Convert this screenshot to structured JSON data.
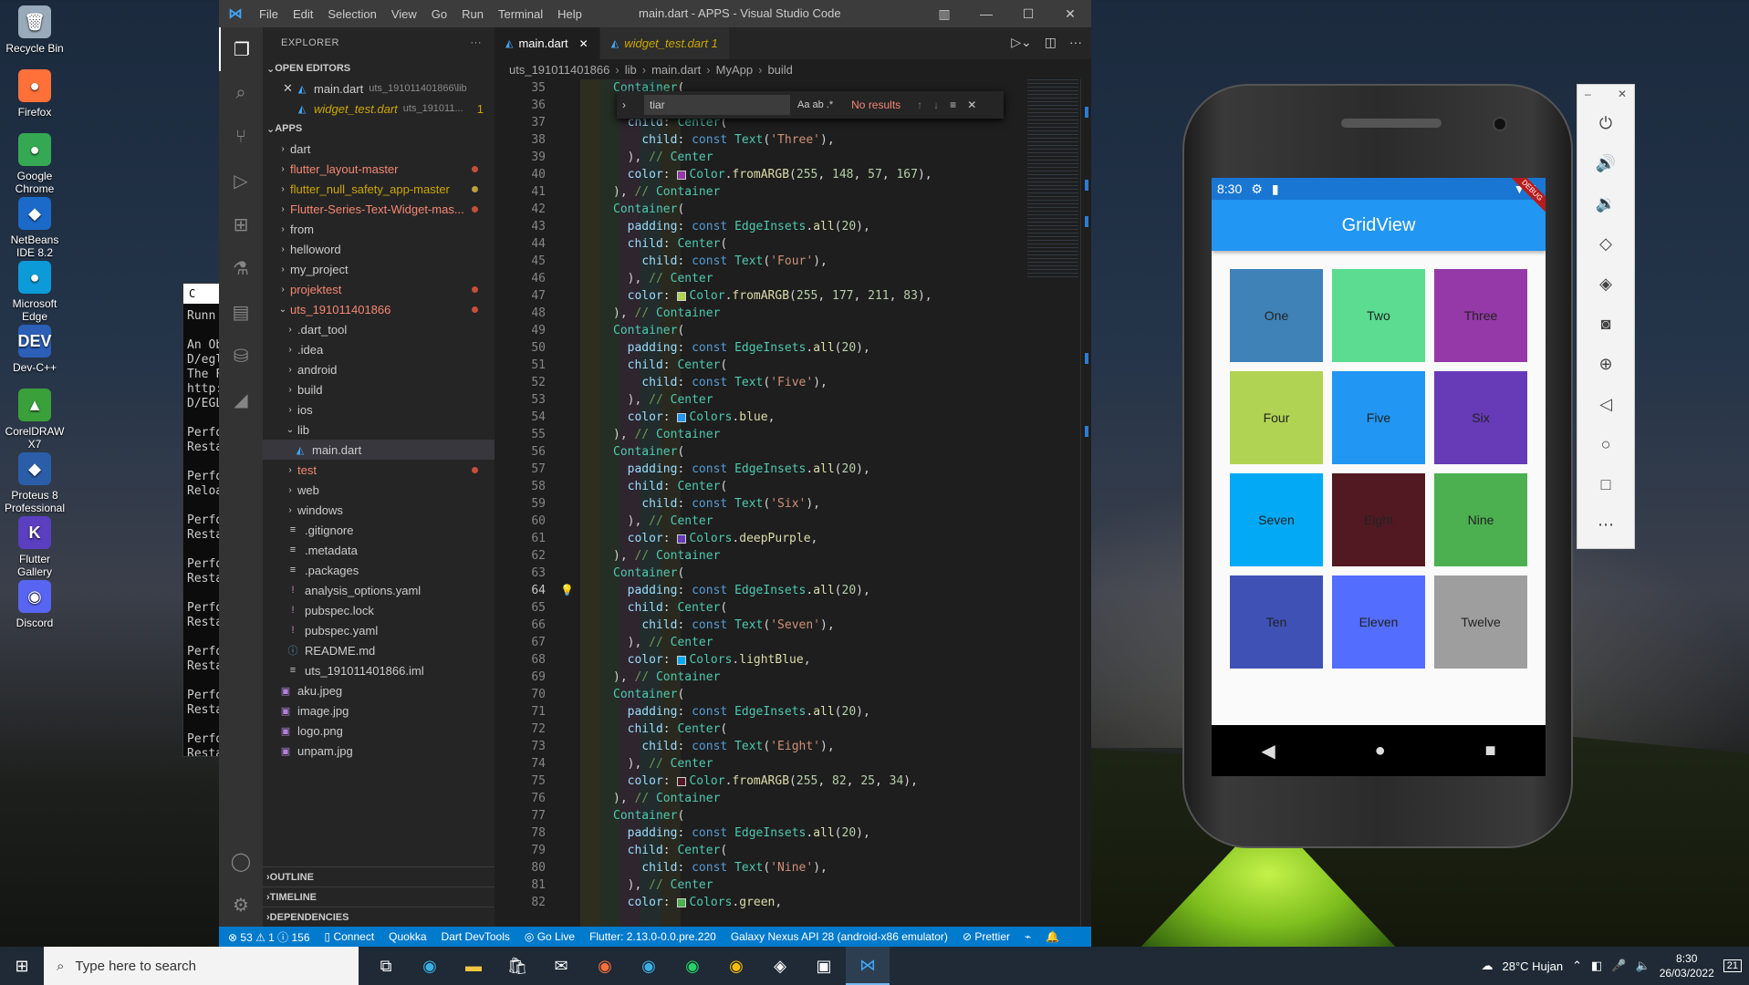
{
  "desktop": {
    "icons": [
      {
        "label": "Recycle Bin",
        "glyph": "🗑",
        "color": "#9ab"
      },
      {
        "label": "Firefox",
        "glyph": "●",
        "color": "#ff7139"
      },
      {
        "label": "Google Chrome",
        "glyph": "●",
        "color": "#34a853"
      },
      {
        "label": "NetBeans IDE 8.2",
        "glyph": "◆",
        "color": "#1b6ac9"
      },
      {
        "label": "Microsoft Edge",
        "glyph": "●",
        "color": "#0c9bd8"
      },
      {
        "label": "Dev-C++",
        "glyph": "DEV",
        "color": "#2b5fb8"
      },
      {
        "label": "CorelDRAW X7",
        "glyph": "▲",
        "color": "#3aa03a"
      },
      {
        "label": "Proteus 8 Professional",
        "glyph": "◆",
        "color": "#2a5ea8"
      },
      {
        "label": "Flutter Gallery",
        "glyph": "K",
        "color": "#5a3fc0"
      },
      {
        "label": "Discord",
        "glyph": "◉",
        "color": "#5865f2"
      }
    ]
  },
  "terminal": {
    "title": "C",
    "lines": [
      "Runn",
      "",
      "An Ob",
      "D/egl",
      "The F",
      "http:",
      "D/EGL",
      "",
      "Perfo",
      "Resta",
      "",
      "Perfo",
      "Reloa",
      "",
      "Perfo",
      "Resta",
      "",
      "Perfo",
      "Resta",
      "",
      "Perfo",
      "Resta",
      "",
      "Perfo",
      "Resta",
      "",
      "Perfo",
      "Resta",
      "",
      "Perfo",
      "Resta"
    ]
  },
  "vscode": {
    "menu": [
      "File",
      "Edit",
      "Selection",
      "View",
      "Go",
      "Run",
      "Terminal",
      "Help"
    ],
    "window_title": "main.dart - APPS - Visual Studio Code",
    "explorer_title": "EXPLORER",
    "open_editors_label": "OPEN EDITORS",
    "open_editors": [
      {
        "name": "main.dart",
        "path": "uts_191011401866\\lib",
        "modified": false
      },
      {
        "name": "widget_test.dart",
        "path": "uts_191011...",
        "badge": "1",
        "modified": true
      }
    ],
    "apps_label": "APPS",
    "tree": [
      {
        "name": "dart",
        "indent": 0,
        "kind": "folder",
        "color": "normal"
      },
      {
        "name": "flutter_layout-master",
        "indent": 0,
        "kind": "folder",
        "color": "red",
        "dot": "red"
      },
      {
        "name": "flutter_null_safety_app-master",
        "indent": 0,
        "kind": "folder",
        "color": "yellow",
        "dot": "yellow"
      },
      {
        "name": "Flutter-Series-Text-Widget-mas...",
        "indent": 0,
        "kind": "folder",
        "color": "red",
        "dot": "red"
      },
      {
        "name": "from",
        "indent": 0,
        "kind": "folder",
        "color": "normal"
      },
      {
        "name": "helloword",
        "indent": 0,
        "kind": "folder",
        "color": "normal"
      },
      {
        "name": "my_project",
        "indent": 0,
        "kind": "folder",
        "color": "normal"
      },
      {
        "name": "projektest",
        "indent": 0,
        "kind": "folder",
        "color": "red",
        "dot": "red"
      },
      {
        "name": "uts_191011401866",
        "indent": 0,
        "kind": "folder-open",
        "color": "red",
        "dot": "red"
      },
      {
        "name": ".dart_tool",
        "indent": 1,
        "kind": "folder",
        "color": "normal"
      },
      {
        "name": ".idea",
        "indent": 1,
        "kind": "folder",
        "color": "normal"
      },
      {
        "name": "android",
        "indent": 1,
        "kind": "folder",
        "color": "normal"
      },
      {
        "name": "build",
        "indent": 1,
        "kind": "folder",
        "color": "normal"
      },
      {
        "name": "ios",
        "indent": 1,
        "kind": "folder",
        "color": "normal"
      },
      {
        "name": "lib",
        "indent": 1,
        "kind": "folder-open",
        "color": "normal"
      },
      {
        "name": "main.dart",
        "indent": 2,
        "kind": "dart",
        "color": "normal",
        "selected": true
      },
      {
        "name": "test",
        "indent": 1,
        "kind": "folder",
        "color": "red",
        "dot": "red"
      },
      {
        "name": "web",
        "indent": 1,
        "kind": "folder",
        "color": "normal"
      },
      {
        "name": "windows",
        "indent": 1,
        "kind": "folder",
        "color": "normal"
      },
      {
        "name": ".gitignore",
        "indent": 1,
        "kind": "file",
        "color": "normal"
      },
      {
        "name": ".metadata",
        "indent": 1,
        "kind": "file",
        "color": "normal"
      },
      {
        "name": ".packages",
        "indent": 1,
        "kind": "file",
        "color": "normal"
      },
      {
        "name": "analysis_options.yaml",
        "indent": 1,
        "kind": "yaml",
        "color": "normal"
      },
      {
        "name": "pubspec.lock",
        "indent": 1,
        "kind": "yaml",
        "color": "normal"
      },
      {
        "name": "pubspec.yaml",
        "indent": 1,
        "kind": "yaml",
        "color": "normal"
      },
      {
        "name": "README.md",
        "indent": 1,
        "kind": "info",
        "color": "normal"
      },
      {
        "name": "uts_191011401866.iml",
        "indent": 1,
        "kind": "file",
        "color": "normal"
      },
      {
        "name": "aku.jpeg",
        "indent": 0,
        "kind": "image",
        "color": "normal"
      },
      {
        "name": "image.jpg",
        "indent": 0,
        "kind": "image",
        "color": "normal"
      },
      {
        "name": "logo.png",
        "indent": 0,
        "kind": "image",
        "color": "normal"
      },
      {
        "name": "unpam.jpg",
        "indent": 0,
        "kind": "image",
        "color": "normal"
      }
    ],
    "bottom_sections": [
      "OUTLINE",
      "TIMELINE",
      "DEPENDENCIES"
    ],
    "tabs": [
      {
        "label": "main.dart",
        "active": true
      },
      {
        "label": "widget_test.dart 1",
        "active": false
      }
    ],
    "breadcrumb": [
      "uts_191011401866",
      "lib",
      "main.dart",
      "MyApp",
      "build"
    ],
    "find": {
      "query": "tiar",
      "opts": "Aa  ab  .*",
      "result": "No results"
    },
    "code_start": 35,
    "current_line": 64,
    "code": [
      "Container(",
      "  padding: const EdgeInsets.all(20),",
      "  child: Center(",
      "    child: const Text('Three'),",
      "  ), // Center",
      "  color: Color.fromARGB(255, 148, 57, 167),",
      "), // Container",
      "Container(",
      "  padding: const EdgeInsets.all(20),",
      "  child: Center(",
      "    child: const Text('Four'),",
      "  ), // Center",
      "  color: Color.fromARGB(255, 177, 211, 83),",
      "), // Container",
      "Container(",
      "  padding: const EdgeInsets.all(20),",
      "  child: Center(",
      "    child: const Text('Five'),",
      "  ), // Center",
      "  color: Colors.blue,",
      "), // Container",
      "Container(",
      "  padding: const EdgeInsets.all(20),",
      "  child: Center(",
      "    child: const Text('Six'),",
      "  ), // Center",
      "  color: Colors.deepPurple,",
      "), // Container",
      "Container(",
      "  padding: const EdgeInsets.all(20),",
      "  child: Center(",
      "    child: const Text('Seven'),",
      "  ), // Center",
      "  color: Colors.lightBlue,",
      "), // Container",
      "Container(",
      "  padding: const EdgeInsets.all(20),",
      "  child: Center(",
      "    child: const Text('Eight'),",
      "  ), // Center",
      "  color: Color.fromARGB(255, 82, 25, 34),",
      "), // Container",
      "Container(",
      "  padding: const EdgeInsets.all(20),",
      "  child: Center(",
      "    child: const Text('Nine'),",
      "  ), // Center",
      "  color: Colors.green,"
    ],
    "swatches": {
      "Color.fromARGB(255, 148, 57, 167)": "#9439a7",
      "Color.fromARGB(255, 177, 211, 83)": "#b1d353",
      "Colors.blue": "#2196f3",
      "Colors.deepPurple": "#673ab7",
      "Colors.lightBlue": "#03a9f4",
      "Color.fromARGB(255, 82, 25, 34)": "#521922",
      "Colors.green": "#4caf50"
    },
    "status": [
      "⊗ 53 ⚠ 1 ⓘ 156",
      "▯ Connect",
      "Quokka",
      "Dart DevTools",
      "◎ Go Live",
      "Flutter: 2.13.0-0.0.pre.220",
      "Galaxy Nexus API 28 (android-x86 emulator)",
      "⊘ Prettier"
    ]
  },
  "phone": {
    "time": "8:30",
    "debug_label": "DEBUG",
    "app_title": "GridView",
    "cells": [
      {
        "label": "One",
        "color": "#3e82b8",
        "text": "#222"
      },
      {
        "label": "Two",
        "color": "#5bdc91",
        "text": "#222"
      },
      {
        "label": "Three",
        "color": "#9439a7",
        "text": "#222"
      },
      {
        "label": "Four",
        "color": "#b1d353",
        "text": "#222"
      },
      {
        "label": "Five",
        "color": "#2196f3",
        "text": "#222"
      },
      {
        "label": "Six",
        "color": "#673ab7",
        "text": "#222"
      },
      {
        "label": "Seven",
        "color": "#03a9f4",
        "text": "#222"
      },
      {
        "label": "Eight",
        "color": "#521922",
        "text": "#222"
      },
      {
        "label": "Nine",
        "color": "#4caf50",
        "text": "#222"
      },
      {
        "label": "Ten",
        "color": "#3f51b5",
        "text": "#222"
      },
      {
        "label": "Eleven",
        "color": "#536dfe",
        "text": "#222"
      },
      {
        "label": "Twelve",
        "color": "#9e9e9e",
        "text": "#222"
      }
    ]
  },
  "emulator_controls": [
    "power-icon",
    "volume-up-icon",
    "volume-down-icon",
    "rotate-left-icon",
    "rotate-right-icon",
    "camera-icon",
    "zoom-icon",
    "back-icon",
    "home-icon",
    "overview-icon",
    "more-icon"
  ],
  "taskbar": {
    "search_placeholder": "Type here to search",
    "weather": "28°C  Hujan",
    "time": "8:30",
    "date": "26/03/2022",
    "notification_count": "21"
  }
}
